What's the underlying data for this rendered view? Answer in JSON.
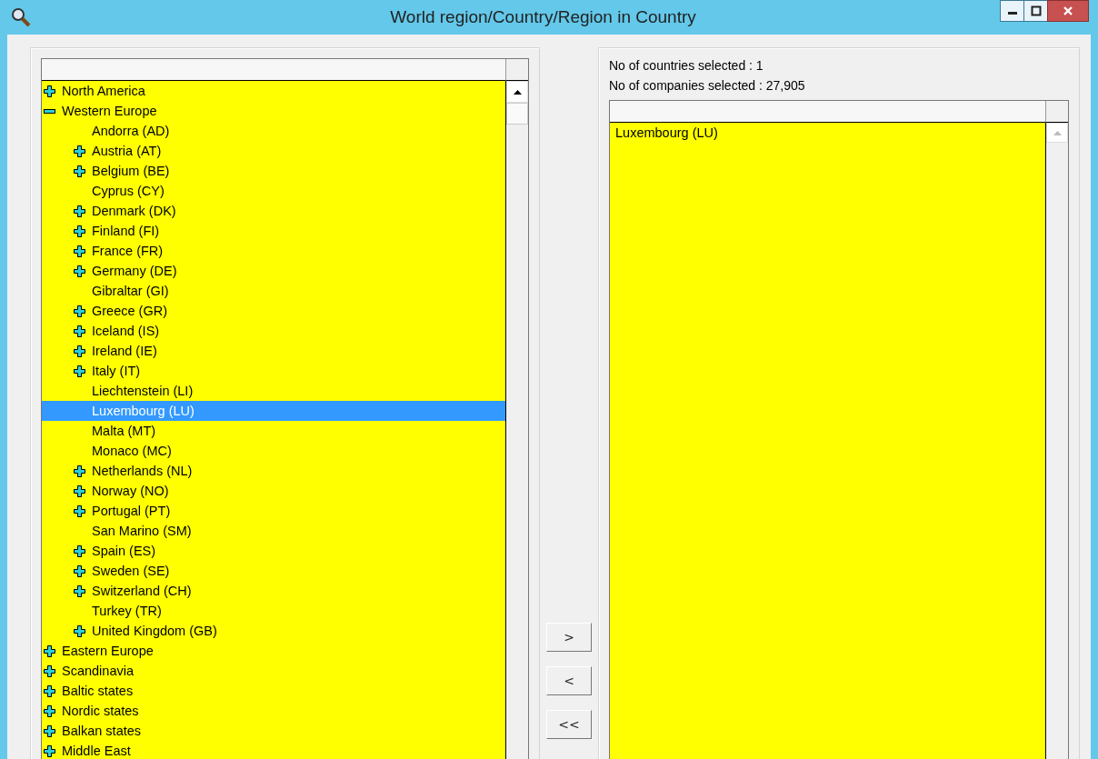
{
  "window": {
    "title": "World region/Country/Region in Country"
  },
  "tree": [
    {
      "label": "North America",
      "kind": "node",
      "expanded": false,
      "selected": false
    },
    {
      "label": "Western Europe",
      "kind": "node",
      "expanded": true,
      "selected": false,
      "children": [
        {
          "label": "Andorra (AD)",
          "kind": "leaf",
          "selected": false
        },
        {
          "label": "Austria (AT)",
          "kind": "node",
          "expanded": false,
          "selected": false
        },
        {
          "label": "Belgium (BE)",
          "kind": "node",
          "expanded": false,
          "selected": false
        },
        {
          "label": "Cyprus (CY)",
          "kind": "leaf",
          "selected": false
        },
        {
          "label": "Denmark (DK)",
          "kind": "node",
          "expanded": false,
          "selected": false
        },
        {
          "label": "Finland (FI)",
          "kind": "node",
          "expanded": false,
          "selected": false
        },
        {
          "label": "France (FR)",
          "kind": "node",
          "expanded": false,
          "selected": false
        },
        {
          "label": "Germany (DE)",
          "kind": "node",
          "expanded": false,
          "selected": false
        },
        {
          "label": "Gibraltar (GI)",
          "kind": "leaf",
          "selected": false
        },
        {
          "label": "Greece (GR)",
          "kind": "node",
          "expanded": false,
          "selected": false
        },
        {
          "label": "Iceland (IS)",
          "kind": "node",
          "expanded": false,
          "selected": false
        },
        {
          "label": "Ireland (IE)",
          "kind": "node",
          "expanded": false,
          "selected": false
        },
        {
          "label": "Italy (IT)",
          "kind": "node",
          "expanded": false,
          "selected": false
        },
        {
          "label": "Liechtenstein (LI)",
          "kind": "leaf",
          "selected": false
        },
        {
          "label": "Luxembourg (LU)",
          "kind": "leaf",
          "selected": true
        },
        {
          "label": "Malta (MT)",
          "kind": "leaf",
          "selected": false
        },
        {
          "label": "Monaco (MC)",
          "kind": "leaf",
          "selected": false
        },
        {
          "label": "Netherlands (NL)",
          "kind": "node",
          "expanded": false,
          "selected": false
        },
        {
          "label": "Norway (NO)",
          "kind": "node",
          "expanded": false,
          "selected": false
        },
        {
          "label": "Portugal (PT)",
          "kind": "node",
          "expanded": false,
          "selected": false
        },
        {
          "label": "San Marino (SM)",
          "kind": "leaf",
          "selected": false
        },
        {
          "label": "Spain (ES)",
          "kind": "node",
          "expanded": false,
          "selected": false
        },
        {
          "label": "Sweden (SE)",
          "kind": "node",
          "expanded": false,
          "selected": false
        },
        {
          "label": "Switzerland (CH)",
          "kind": "node",
          "expanded": false,
          "selected": false
        },
        {
          "label": "Turkey (TR)",
          "kind": "leaf",
          "selected": false
        },
        {
          "label": "United Kingdom (GB)",
          "kind": "node",
          "expanded": false,
          "selected": false
        }
      ]
    },
    {
      "label": "Eastern Europe",
      "kind": "node",
      "expanded": false,
      "selected": false
    },
    {
      "label": "Scandinavia",
      "kind": "node",
      "expanded": false,
      "selected": false
    },
    {
      "label": "Baltic states",
      "kind": "node",
      "expanded": false,
      "selected": false
    },
    {
      "label": "Nordic states",
      "kind": "node",
      "expanded": false,
      "selected": false
    },
    {
      "label": "Balkan states",
      "kind": "node",
      "expanded": false,
      "selected": false
    },
    {
      "label": "Middle East",
      "kind": "node",
      "expanded": false,
      "selected": false
    }
  ],
  "summary": [
    "No of countries selected : 1",
    "No of companies selected : 27,905"
  ],
  "buttons": [
    ">",
    "<",
    "<<"
  ],
  "selected_list": [
    "Luxembourg (LU)"
  ]
}
